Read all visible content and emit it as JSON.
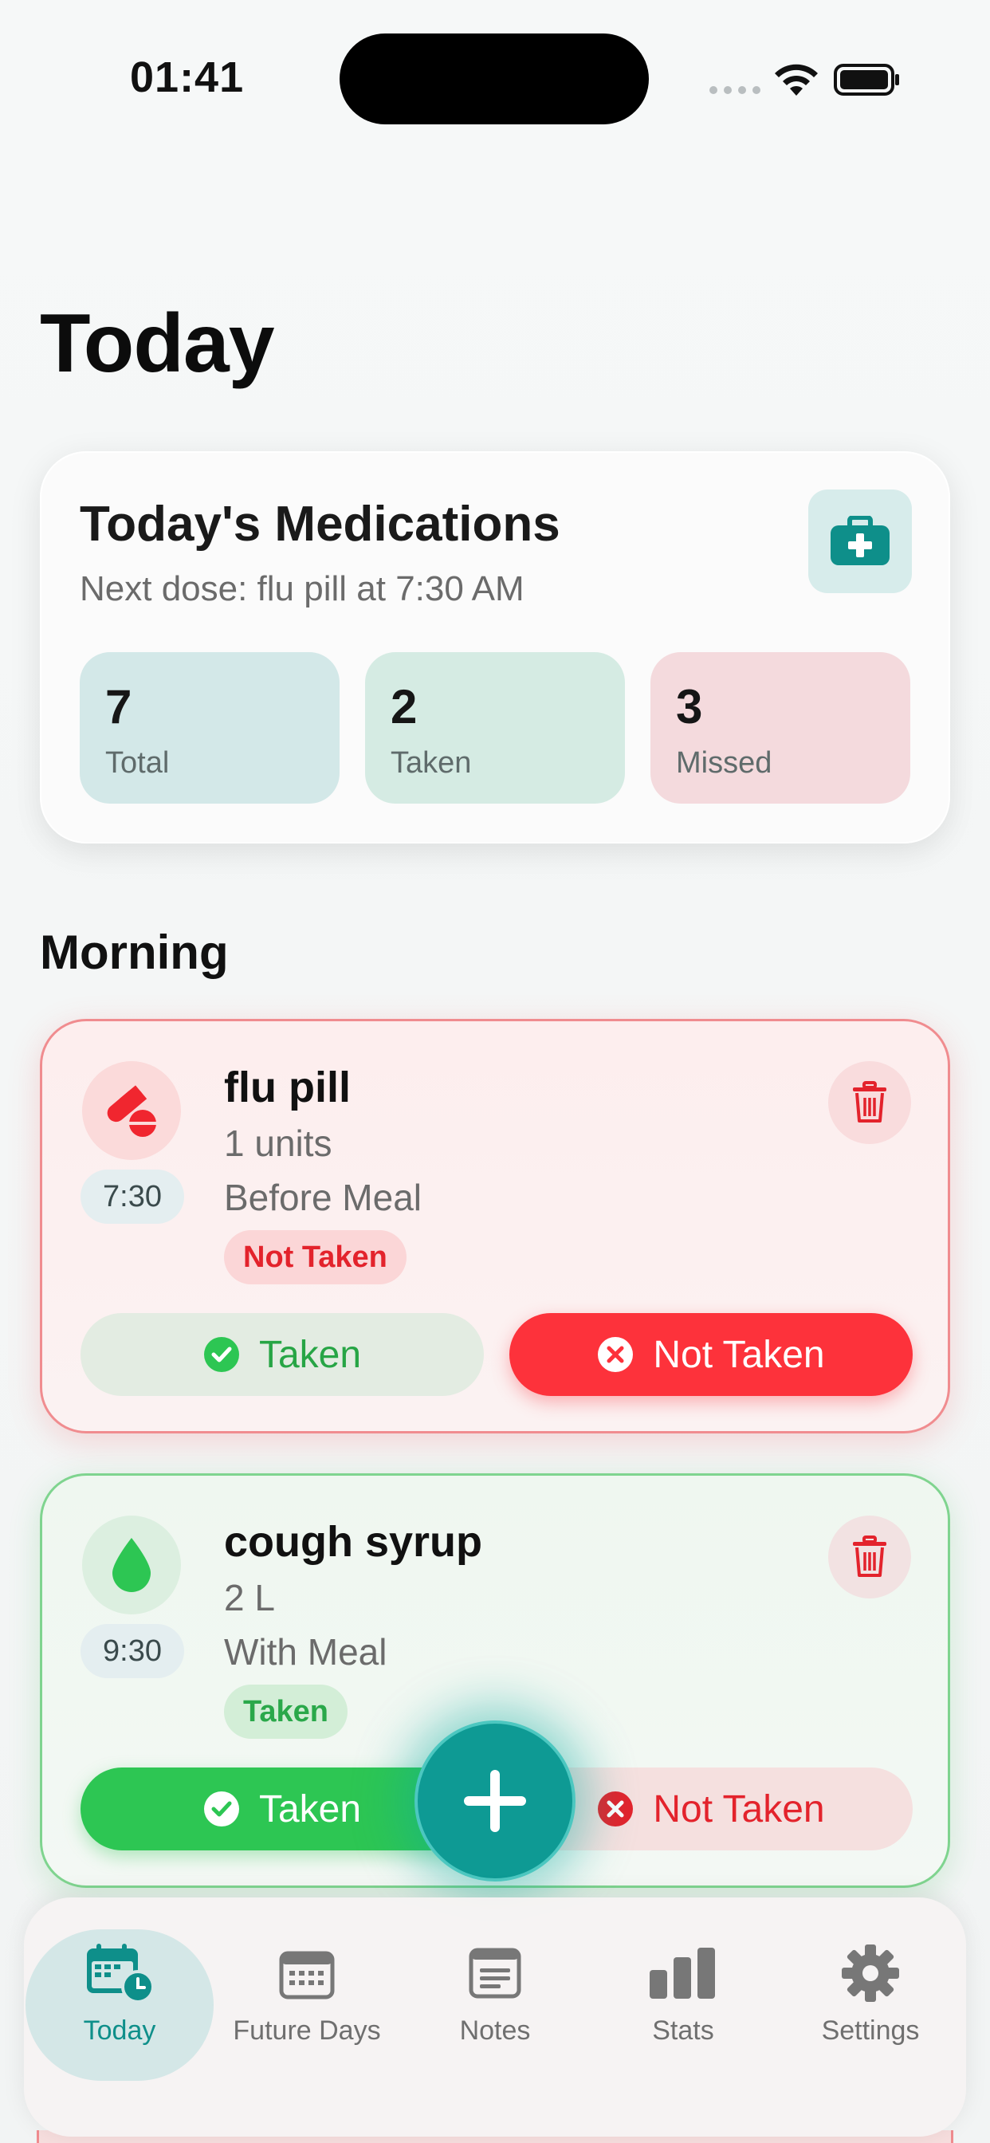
{
  "status_bar": {
    "time": "01:41"
  },
  "page": {
    "title": "Today"
  },
  "summary": {
    "title": "Today's Medications",
    "subtitle": "Next dose: flu pill at 7:30 AM",
    "stats": [
      {
        "value": "7",
        "label": "Total"
      },
      {
        "value": "2",
        "label": "Taken"
      },
      {
        "value": "3",
        "label": "Missed"
      }
    ]
  },
  "section": {
    "title": "Morning"
  },
  "meds": [
    {
      "name": "flu pill",
      "dose": "1 units",
      "when": "Before Meal",
      "time": "7:30",
      "status": "Not Taken",
      "taken_label": "Taken",
      "not_taken_label": "Not Taken"
    },
    {
      "name": "cough syrup",
      "dose": "2 L",
      "when": "With Meal",
      "time": "9:30",
      "status": "Taken",
      "taken_label": "Taken",
      "not_taken_label": "Not Taken"
    }
  ],
  "tabs": [
    {
      "label": "Today",
      "icon": "calendar-clock-icon",
      "active": true
    },
    {
      "label": "Future Days",
      "icon": "calendar-icon"
    },
    {
      "label": "Notes",
      "icon": "note-icon"
    },
    {
      "label": "Stats",
      "icon": "bar-chart-icon"
    },
    {
      "label": "Settings",
      "icon": "gear-icon"
    }
  ],
  "colors": {
    "accent": "#0e9a94",
    "taken": "#2dc653",
    "missed": "#fd323b"
  }
}
